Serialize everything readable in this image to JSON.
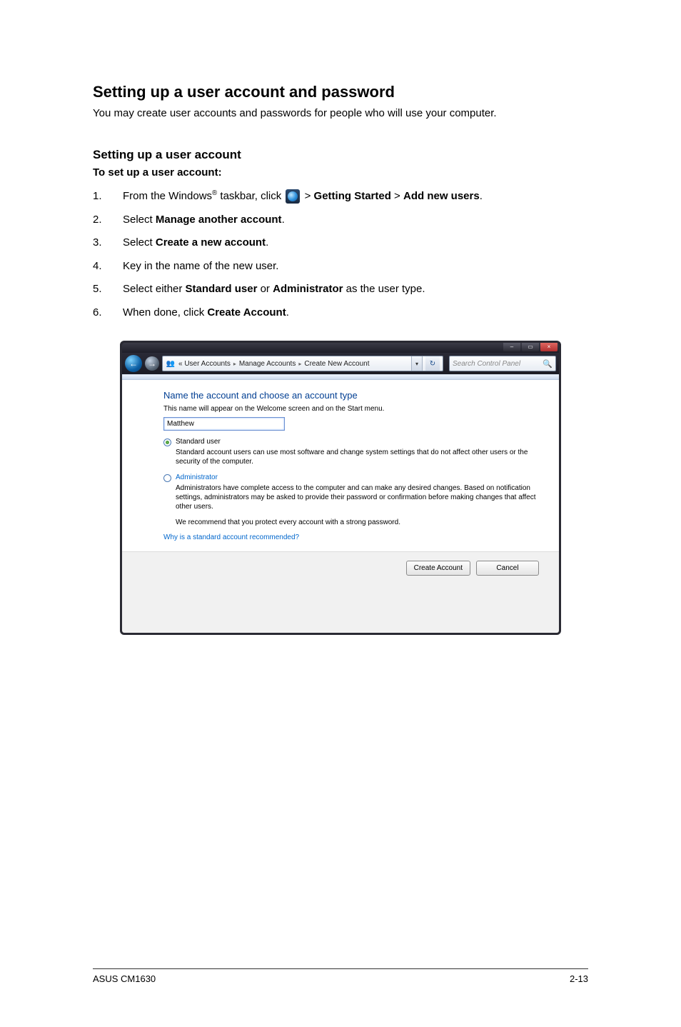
{
  "doc": {
    "title": "Setting up a user account and password",
    "intro": "You may create user accounts and passwords for people who will use your computer.",
    "subsection_title": "Setting up a user account",
    "sub_label": "To set up a user account:"
  },
  "steps": {
    "items": [
      {
        "num": "1.",
        "pre": "From the Windows",
        "reg": "®",
        "mid": " taskbar, click ",
        "after": " > ",
        "b1": "Getting Started",
        "b2_sep": " > ",
        "b2": "Add new users",
        "tail": "."
      },
      {
        "num": "2.",
        "text_pre": "Select ",
        "bold": "Manage another account",
        "text_post": "."
      },
      {
        "num": "3.",
        "text_pre": "Select ",
        "bold": "Create a new account",
        "text_post": "."
      },
      {
        "num": "4.",
        "plain": "Key in the name of the new user."
      },
      {
        "num": "5.",
        "t1": "Select either ",
        "b1": "Standard user",
        "t2": " or ",
        "b2": "Administrator",
        "t3": " as the user type."
      },
      {
        "num": "6.",
        "text_pre": "When done, click ",
        "bold": "Create Account",
        "text_post": "."
      }
    ]
  },
  "window": {
    "min_icon": "–",
    "max_icon": "▭",
    "close_icon": "×",
    "back_icon": "←",
    "fwd_icon": "→",
    "breadcrumb": {
      "icon": "👥",
      "p1": "« User Accounts",
      "sep": "▸",
      "p2": "Manage Accounts",
      "p3": "Create New Account",
      "dd": "▾",
      "refresh": "↻"
    },
    "search": {
      "placeholder": "Search Control Panel",
      "icon": "🔍"
    },
    "content": {
      "heading": "Name the account and choose an account type",
      "subline": "This name will appear on the Welcome screen and on the Start menu.",
      "name_value": "Matthew",
      "std_label": "Standard user",
      "std_desc": "Standard account users can use most software and change system settings that do not affect other users or the security of the computer.",
      "admin_label": "Administrator",
      "admin_desc": "Administrators have complete access to the computer and can make any desired changes. Based on notification settings, administrators may be asked to provide their password or confirmation before making changes that affect other users.",
      "recommend": "We recommend that you protect every account with a strong password.",
      "why_link": "Why is a standard account recommended?"
    },
    "buttons": {
      "create": "Create Account",
      "cancel": "Cancel"
    }
  },
  "footer": {
    "left": "ASUS CM1630",
    "right": "2-13"
  }
}
